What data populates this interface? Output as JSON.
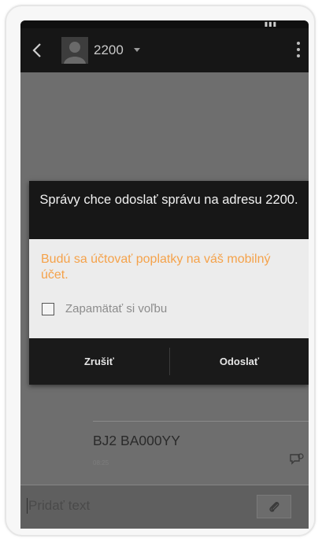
{
  "app_bar": {
    "title": "2200",
    "back_icon": "chevron-left-icon",
    "overflow_icon": "more-vert-icon",
    "avatar_icon": "contact-avatar-icon"
  },
  "dialog": {
    "title": "Správy chce odoslať správu na adresu 2200.",
    "warning": "Budú sa účtovať poplatky na váš mobilný účet.",
    "checkbox_label": "Zapamätať si voľbu",
    "checkbox_checked": false,
    "cancel_label": "Zrušiť",
    "send_label": "Odoslať"
  },
  "message": {
    "text": "BJ2 BA000YY",
    "time": "08:25",
    "status_icon": "message-status-icon"
  },
  "composer": {
    "placeholder": "Pridať text",
    "attach_icon": "paperclip-icon"
  },
  "colors": {
    "app_bar": "#161616",
    "dialog_header": "#171717",
    "dialog_body": "#ececec",
    "warning_text": "#f5a24a",
    "screen_dim": "#6e6e6e"
  }
}
